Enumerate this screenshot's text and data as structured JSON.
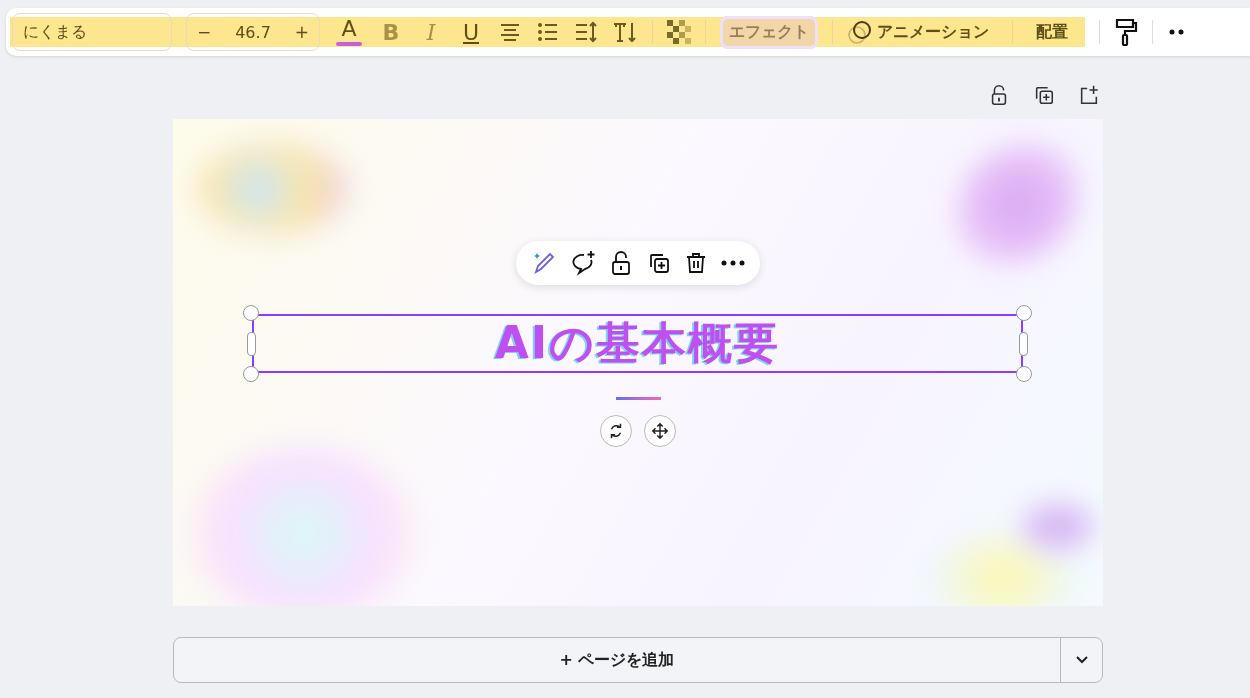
{
  "toolbar": {
    "font": "にくまる",
    "font_size": {
      "minus": "−",
      "value": "46.7",
      "plus": "+"
    },
    "buttons": [
      {
        "kind": "text-color",
        "label": "A",
        "color": "#c45fe0"
      },
      {
        "kind": "bold",
        "label": "B",
        "disabled": true
      },
      {
        "kind": "italic",
        "label": "I",
        "disabled": true
      },
      {
        "kind": "underline",
        "label": "U"
      },
      {
        "kind": "align"
      },
      {
        "kind": "list"
      },
      {
        "kind": "spacing"
      },
      {
        "kind": "vertical-text"
      },
      {
        "kind": "transparency"
      }
    ],
    "effects": {
      "label": "エフェクト",
      "selected": true
    },
    "animation": {
      "label": "アニメーション"
    },
    "position": {
      "label": "配置"
    }
  },
  "canvas": {
    "title": "AIの基本概要"
  },
  "add_page": {
    "label": "+ ページを追加"
  }
}
